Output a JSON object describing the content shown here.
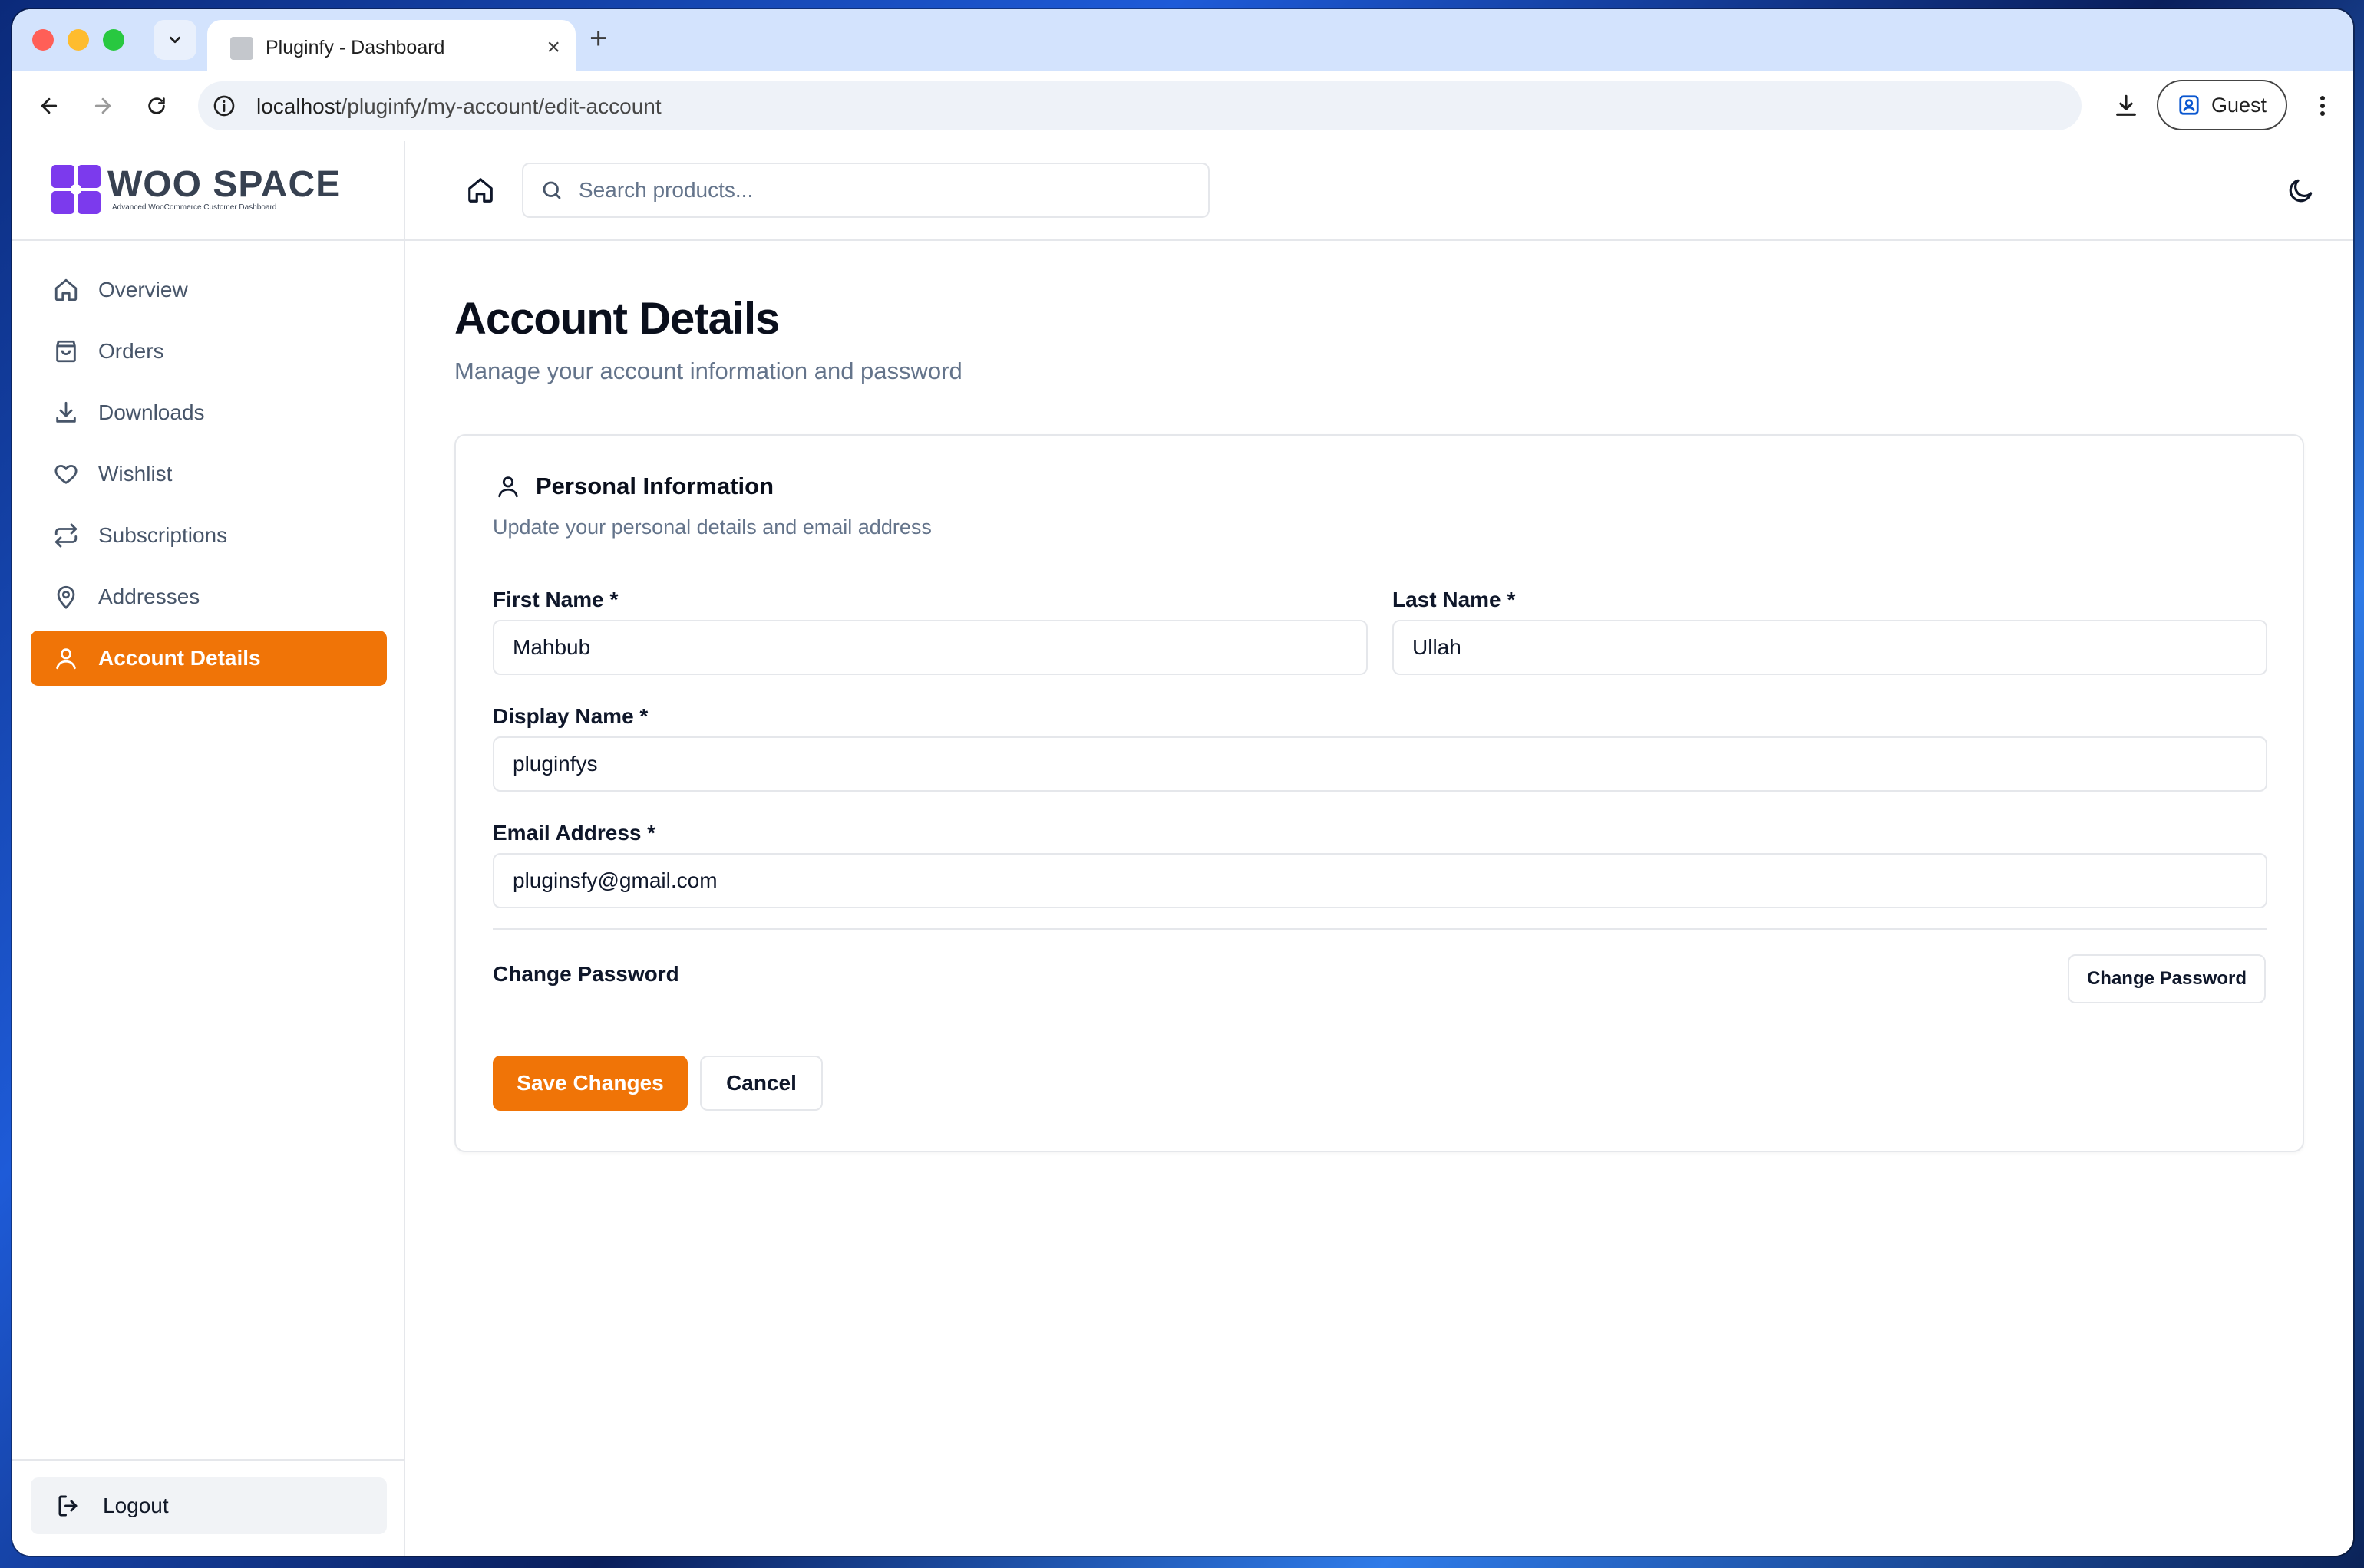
{
  "browser": {
    "tab_title": "Pluginfy - Dashboard",
    "new_tab": "+",
    "tab_close": "×",
    "url_host": "localhost",
    "url_path": "/pluginfy/my-account/edit-account",
    "profile_label": "Guest"
  },
  "brand": {
    "name": "WOO SPACE",
    "tagline": "Advanced WooCommerce Customer Dashboard",
    "logo_color": "#7c3aed"
  },
  "sidebar": {
    "items": [
      {
        "label": "Overview",
        "icon": "home-icon"
      },
      {
        "label": "Orders",
        "icon": "shopping-bag-icon"
      },
      {
        "label": "Downloads",
        "icon": "download-icon"
      },
      {
        "label": "Wishlist",
        "icon": "heart-icon"
      },
      {
        "label": "Subscriptions",
        "icon": "repeat-icon"
      },
      {
        "label": "Addresses",
        "icon": "map-pin-icon"
      },
      {
        "label": "Account Details",
        "icon": "user-icon",
        "active": true
      }
    ],
    "logout_label": "Logout"
  },
  "topbar": {
    "search_placeholder": "Search products..."
  },
  "page": {
    "title": "Account Details",
    "subtitle": "Manage your account information and password"
  },
  "personal": {
    "title": "Personal Information",
    "subtitle": "Update your personal details and email address",
    "first_name_label": "First Name *",
    "first_name_value": "Mahbub",
    "last_name_label": "Last Name *",
    "last_name_value": "Ullah",
    "display_name_label": "Display Name *",
    "display_name_value": "pluginfys",
    "email_label": "Email Address *",
    "email_value": "pluginsfy@gmail.com",
    "change_password_label": "Change Password",
    "change_password_button": "Change Password",
    "save_button": "Save Changes",
    "cancel_button": "Cancel"
  },
  "colors": {
    "accent": "#f07407",
    "muted_text": "#64748b",
    "border": "#e5e7eb"
  }
}
